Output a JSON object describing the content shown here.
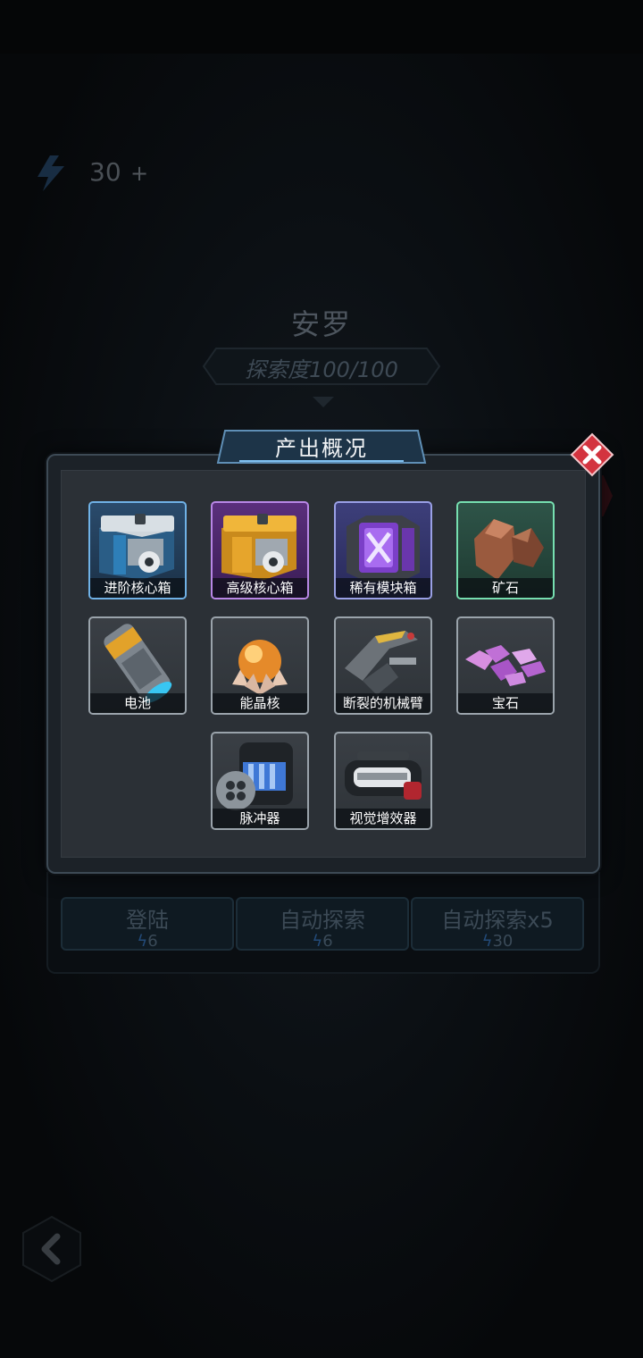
{
  "background": {
    "energy": {
      "value": "30",
      "plus": "+"
    },
    "planet_name": "安罗",
    "exploration": "探索度100/100",
    "actions": [
      {
        "label": "登陆",
        "cost": "6"
      },
      {
        "label": "自动探索",
        "cost": "6"
      },
      {
        "label": "自动探索x5",
        "cost": "30"
      }
    ]
  },
  "dialog": {
    "title": "产出概况",
    "items": [
      {
        "name": "进阶核心箱",
        "rarity": "blue",
        "icon": "advanced-core-box-icon"
      },
      {
        "name": "高级核心箱",
        "rarity": "purple",
        "icon": "premium-core-box-icon"
      },
      {
        "name": "稀有模块箱",
        "rarity": "purple",
        "icon": "rare-module-box-icon"
      },
      {
        "name": "矿石",
        "rarity": "green",
        "icon": "ore-icon"
      },
      {
        "name": "电池",
        "rarity": "gray",
        "icon": "battery-icon"
      },
      {
        "name": "能晶核",
        "rarity": "gray",
        "icon": "energy-crystal-core-icon"
      },
      {
        "name": "断裂的机械臂",
        "rarity": "gray",
        "icon": "broken-mech-arm-icon"
      },
      {
        "name": "宝石",
        "rarity": "gray",
        "icon": "gem-icon"
      },
      {
        "name": "脉冲器",
        "rarity": "gray",
        "icon": "pulser-icon"
      },
      {
        "name": "视觉增效器",
        "rarity": "gray",
        "icon": "visual-enhancer-icon"
      }
    ]
  },
  "colors": {
    "close": "#d3343f",
    "accent_blue": "#3a8fd6",
    "title_tab": "#1d3448"
  }
}
